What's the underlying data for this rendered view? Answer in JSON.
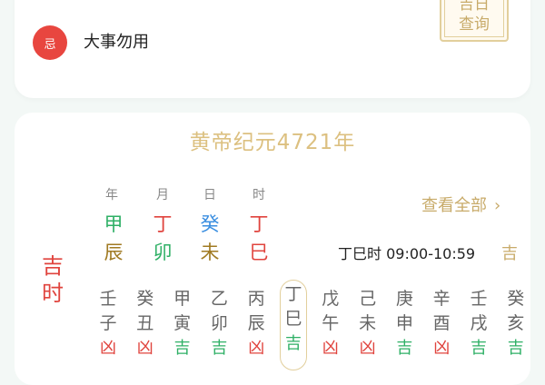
{
  "top_card": {
    "badge": "忌",
    "badge_text": "大事勿用",
    "lookup_button_lines": [
      "吉日",
      "查询"
    ]
  },
  "main_card": {
    "era_title": "黄帝纪元4721年",
    "view_all": "查看全部",
    "pillars": [
      {
        "label": "年",
        "stem": "甲",
        "stem_color": "#2fb066",
        "branch": "辰",
        "branch_color": "#a07a22"
      },
      {
        "label": "月",
        "stem": "丁",
        "stem_color": "#e0443e",
        "branch": "卯",
        "branch_color": "#2fb066"
      },
      {
        "label": "日",
        "stem": "癸",
        "stem_color": "#3a8ee0",
        "branch": "未",
        "branch_color": "#a07a22"
      },
      {
        "label": "时",
        "stem": "丁",
        "stem_color": "#e0443e",
        "branch": "巳",
        "branch_color": "#e0443e"
      }
    ],
    "current_hour": "丁巳时 09:00-10:59",
    "current_hour_luck": "吉",
    "jishi_label": [
      "吉",
      "时"
    ],
    "hours": [
      {
        "stem": "壬",
        "branch": "子",
        "luck": "凶",
        "current": false
      },
      {
        "stem": "癸",
        "branch": "丑",
        "luck": "凶",
        "current": false
      },
      {
        "stem": "甲",
        "branch": "寅",
        "luck": "吉",
        "current": false
      },
      {
        "stem": "乙",
        "branch": "卯",
        "luck": "吉",
        "current": false
      },
      {
        "stem": "丙",
        "branch": "辰",
        "luck": "凶",
        "current": false
      },
      {
        "stem": "丁",
        "branch": "巳",
        "luck": "吉",
        "current": true
      },
      {
        "stem": "戊",
        "branch": "午",
        "luck": "凶",
        "current": false
      },
      {
        "stem": "己",
        "branch": "未",
        "luck": "凶",
        "current": false
      },
      {
        "stem": "庚",
        "branch": "申",
        "luck": "吉",
        "current": false
      },
      {
        "stem": "辛",
        "branch": "酉",
        "luck": "凶",
        "current": false
      },
      {
        "stem": "壬",
        "branch": "戌",
        "luck": "吉",
        "current": false
      },
      {
        "stem": "癸",
        "branch": "亥",
        "luck": "吉",
        "current": false
      }
    ],
    "colors": {
      "good": "#2fb066",
      "bad": "#e0443e",
      "gold": "#c8ab6a"
    }
  }
}
